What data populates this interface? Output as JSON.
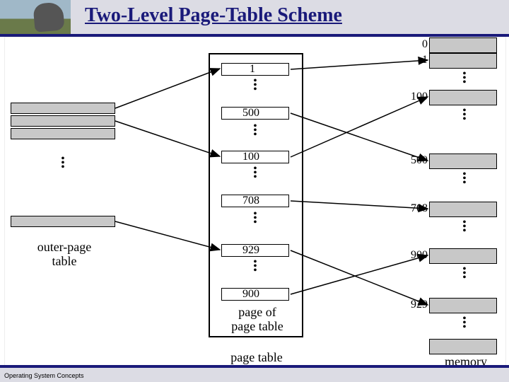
{
  "header": {
    "title": "Two-Level Page-Table Scheme"
  },
  "footer": {
    "text": "Operating System Concepts"
  },
  "labels": {
    "outer": "outer-page\ntable",
    "pagetable": "page table",
    "pageof": "page of\npage table",
    "memory": "memory"
  },
  "outer_table": {
    "rows": 4
  },
  "inner_pages": [
    {
      "entries": [
        "1",
        "500"
      ]
    },
    {
      "entries": [
        "100",
        "708"
      ]
    },
    {
      "entries": [
        "929",
        "900"
      ]
    }
  ],
  "memory_frames": [
    "0",
    "1",
    "100",
    "500",
    "708",
    "900",
    "929"
  ]
}
